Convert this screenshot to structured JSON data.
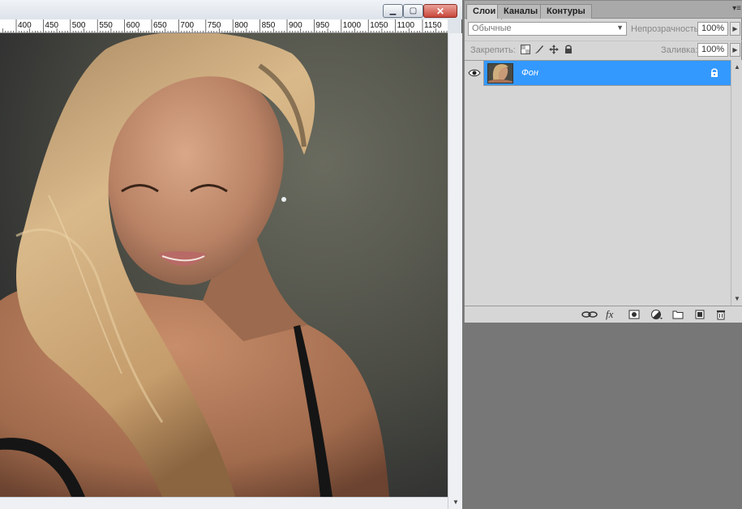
{
  "document": {
    "window_buttons": {
      "minimize": "▁",
      "maximize": "▢",
      "close": "✕"
    },
    "ruler_labels": [
      "400",
      "450",
      "500",
      "550",
      "600",
      "650",
      "700",
      "750",
      "800",
      "850",
      "900",
      "950",
      "1000",
      "1050",
      "1100",
      "1150"
    ]
  },
  "layers_panel": {
    "tabs": [
      {
        "label": "Слои",
        "active": true
      },
      {
        "label": "Каналы",
        "active": false
      },
      {
        "label": "Контуры",
        "active": false
      }
    ],
    "menu_icon": "panel-menu-icon",
    "blend_mode": "Обычные",
    "opacity_label": "Непрозрачность:",
    "opacity_value": "100%",
    "lock_label": "Закрепить:",
    "fill_label": "Заливка:",
    "fill_value": "100%",
    "layers": [
      {
        "name": "Фон",
        "visible": true,
        "locked": true,
        "selected": true
      }
    ],
    "bottom_icons": [
      "link-layers-icon",
      "fx-icon",
      "mask-icon",
      "adjustment-icon",
      "group-icon",
      "new-layer-icon",
      "trash-icon"
    ],
    "fx_label": "fx"
  },
  "colors": {
    "selection": "#3399ff",
    "panel_bg": "#d6d6d6",
    "workspace_bg": "#777777",
    "close_button": "#c9453a"
  }
}
